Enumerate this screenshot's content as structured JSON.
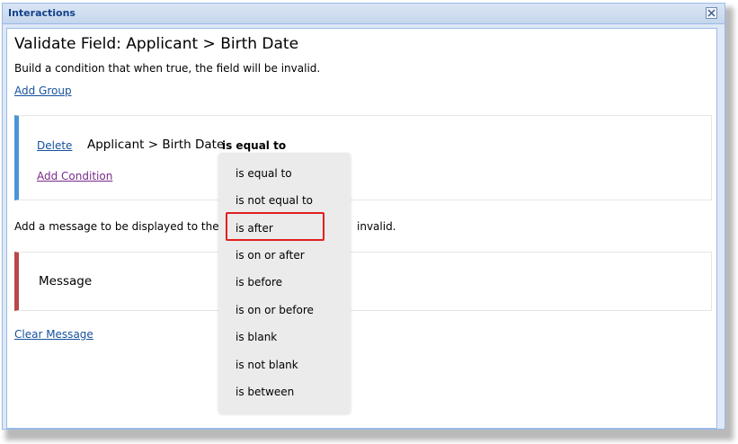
{
  "window": {
    "title": "Interactions"
  },
  "heading": "Validate Field: Applicant > Birth Date",
  "description": "Build a condition that when true, the field will be invalid.",
  "add_group_label": "Add Group",
  "condition": {
    "delete_label": "Delete",
    "field": "Applicant > Birth Date",
    "operator": "is equal to",
    "add_condition_label": "Add Condition"
  },
  "message_prompt_start": "Add a message to be displayed to the e",
  "message_prompt_end": "invalid.",
  "message_panel": {
    "label": "Message"
  },
  "clear_message_label": "Clear Message",
  "dropdown": {
    "options": [
      "is equal to",
      "is not equal to",
      "is after",
      "is on or after",
      "is before",
      "is on or before",
      "is blank",
      "is not blank",
      "is between"
    ],
    "highlighted": "is after"
  },
  "colors": {
    "condition_bar": "#4c94d6",
    "message_bar": "#b94848",
    "highlight_box": "#e02020",
    "link": "#15519e"
  }
}
